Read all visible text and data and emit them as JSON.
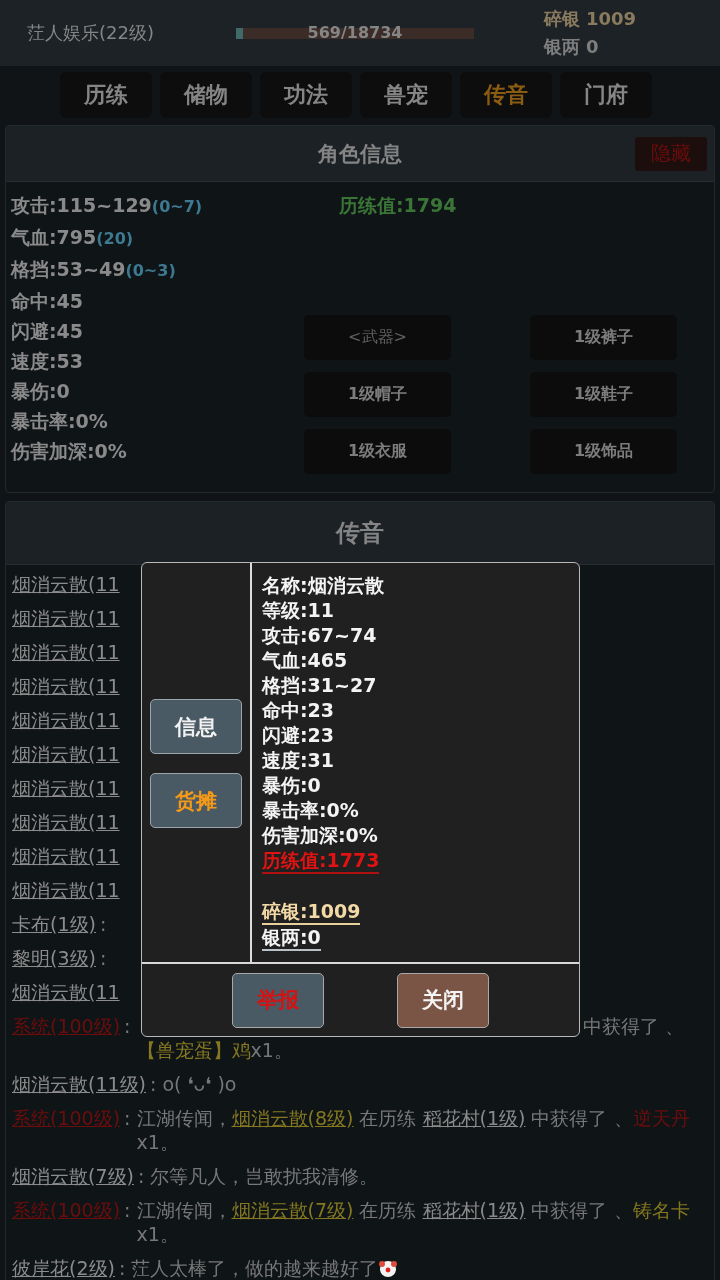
{
  "player": {
    "name": "茳人娱乐(22级)",
    "exp": {
      "text": "569/18734",
      "level": 0.03
    },
    "currency": [
      {
        "label": "碎银",
        "value": "1009",
        "kind": "broken_silver"
      },
      {
        "label": "银两",
        "value": "0",
        "kind": "tael"
      }
    ]
  },
  "tabs": [
    {
      "label": "历练",
      "selected": false
    },
    {
      "label": "储物",
      "selected": false
    },
    {
      "label": "功法",
      "selected": false
    },
    {
      "label": "兽宠",
      "selected": false
    },
    {
      "label": "传音",
      "selected": true
    },
    {
      "label": "门府",
      "selected": false
    }
  ],
  "character_panel": {
    "title": "角色信息",
    "hide_button": "隐藏",
    "stats": [
      {
        "text": "攻击:115~129",
        "bonus": "(0~7)"
      },
      {
        "text": "气血:795",
        "bonus": "(20)"
      },
      {
        "text": "格挡:53~49",
        "bonus": "(0~3)"
      },
      {
        "text": "命中:45"
      },
      {
        "text": "闪避:45"
      },
      {
        "text": "速度:53"
      },
      {
        "text": "暴伤:0"
      },
      {
        "text": "暴击率:0%"
      },
      {
        "text": "伤害加深:0%"
      }
    ],
    "experience": "历练值:1794",
    "equipment": [
      {
        "label": "<武器>",
        "empty": true
      },
      {
        "label": "1级裤子",
        "empty": false
      },
      {
        "label": "1级帽子",
        "empty": false
      },
      {
        "label": "1级鞋子",
        "empty": false
      },
      {
        "label": "1级衣服",
        "empty": false
      },
      {
        "label": "1级饰品",
        "empty": false
      }
    ]
  },
  "chat_panel": {
    "title": "传音",
    "messages": [
      {
        "name": "烟消云散(11",
        "kind": "player"
      },
      {
        "name": "烟消云散(11",
        "kind": "player"
      },
      {
        "name": "烟消云散(11",
        "kind": "player"
      },
      {
        "name": "烟消云散(11",
        "kind": "player"
      },
      {
        "name": "烟消云散(11",
        "kind": "player"
      },
      {
        "name": "烟消云散(11",
        "kind": "player"
      },
      {
        "name": "烟消云散(11",
        "kind": "player"
      },
      {
        "name": "烟消云散(11",
        "kind": "player"
      },
      {
        "name": "烟消云散(11",
        "kind": "player"
      },
      {
        "name": "烟消云散(11",
        "kind": "player"
      },
      {
        "name": "卡布(1级)",
        "kind": "player",
        "separator": ":"
      },
      {
        "name": "黎明(3级)",
        "kind": "player",
        "separator": ":"
      },
      {
        "name": "烟消云散(11",
        "kind": "player"
      },
      {
        "name": "系统(100级)",
        "kind": "system",
        "separator": ":",
        "partly_hidden": true,
        "parts": [
          {
            "text": "中获得了 、",
            "kind": "text"
          },
          {
            "text": "【兽宠蛋】鸡",
            "kind": "item_gold"
          },
          {
            "text": "x1。",
            "kind": "text"
          }
        ]
      },
      {
        "name": "烟消云散(11级)",
        "kind": "player",
        "separator": ":",
        "parts": [
          {
            "text": "o( ❛ᴗ❛ )o",
            "kind": "text"
          }
        ]
      },
      {
        "name": "系统(100级)",
        "kind": "system",
        "separator": ":",
        "parts": [
          {
            "text": "江湖传闻，",
            "kind": "text"
          },
          {
            "text": "烟消云散(8级)",
            "kind": "player"
          },
          {
            "text": " 在历练 ",
            "kind": "text"
          },
          {
            "text": "稻花村(1级)",
            "kind": "place"
          },
          {
            "text": " 中获得了 、",
            "kind": "text"
          },
          {
            "text": "逆天丹",
            "kind": "item_red"
          },
          {
            "text": "x1。",
            "kind": "text"
          }
        ]
      },
      {
        "name": "烟消云散(7级)",
        "kind": "player",
        "separator": ":",
        "parts": [
          {
            "text": "尔等凡人，岂敢扰我清修。",
            "kind": "text"
          }
        ]
      },
      {
        "name": "系统(100级)",
        "kind": "system",
        "separator": ":",
        "parts": [
          {
            "text": "江湖传闻，",
            "kind": "text"
          },
          {
            "text": "烟消云散(7级)",
            "kind": "player"
          },
          {
            "text": " 在历练 ",
            "kind": "text"
          },
          {
            "text": "稻花村(1级)",
            "kind": "place"
          },
          {
            "text": " 中获得了 、",
            "kind": "text"
          },
          {
            "text": "铸名卡",
            "kind": "item_gold"
          },
          {
            "text": "x1。",
            "kind": "text"
          }
        ]
      },
      {
        "name": "彼岸花(2级)",
        "kind": "player",
        "separator": ":",
        "parts": [
          {
            "text": "茳人太棒了，做的越来越好了",
            "kind": "text"
          },
          {
            "kind": "emoji"
          }
        ]
      }
    ]
  },
  "player_dialog": {
    "side_buttons": [
      {
        "label": "信息",
        "kind": "info"
      },
      {
        "label": "货摊",
        "kind": "stall"
      }
    ],
    "info": [
      {
        "text": "名称:烟消云散",
        "kind": "plain"
      },
      {
        "text": "等级:11",
        "kind": "plain"
      },
      {
        "text": "攻击:67~74",
        "kind": "plain"
      },
      {
        "text": "气血:465",
        "kind": "plain"
      },
      {
        "text": "格挡:31~27",
        "kind": "plain"
      },
      {
        "text": "命中:23",
        "kind": "plain"
      },
      {
        "text": "闪避:23",
        "kind": "plain"
      },
      {
        "text": "速度:31",
        "kind": "plain"
      },
      {
        "text": "暴伤:0",
        "kind": "plain"
      },
      {
        "text": "暴击率:0%",
        "kind": "plain"
      },
      {
        "text": "伤害加深:0%",
        "kind": "plain"
      },
      {
        "text": "历练值:1773",
        "kind": "experience"
      },
      {
        "text": "碎银:1009",
        "kind": "broken_silver"
      },
      {
        "text": "银两:0",
        "kind": "tael"
      }
    ],
    "buttons": [
      {
        "label": "举报",
        "kind": "report"
      },
      {
        "label": "关闭",
        "kind": "close"
      }
    ]
  }
}
